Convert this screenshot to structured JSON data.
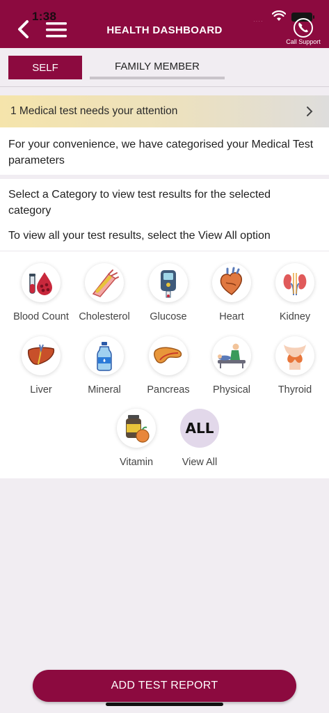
{
  "status_bar": {
    "time": "1:38",
    "signal": "····"
  },
  "header": {
    "title": "HEALTH DASHBOARD",
    "back_icon": "chevron-left-icon",
    "menu_icon": "hamburger-menu-icon",
    "support_icon": "phone-icon",
    "support_label": "Call Support",
    "color": "#8c0a3f"
  },
  "tabs": [
    {
      "label": "SELF",
      "active": true
    },
    {
      "label": "FAMILY MEMBER",
      "active": false
    }
  ],
  "alert": {
    "text": "1 Medical test needs your attention",
    "icon": "chevron-right-icon"
  },
  "info": {
    "text": "For your convenience, we have categorised your Medical Test parameters"
  },
  "categories_panel": {
    "select_text": "Select a Category to view test results for the selected category",
    "view_all_text": "To view all your test results, select the View All option",
    "items": [
      {
        "label": "Blood Count",
        "icon": "blood-count-icon"
      },
      {
        "label": "Cholesterol",
        "icon": "cholesterol-icon"
      },
      {
        "label": "Glucose",
        "icon": "glucose-meter-icon"
      },
      {
        "label": "Heart",
        "icon": "heart-icon"
      },
      {
        "label": "Kidney",
        "icon": "kidney-icon"
      },
      {
        "label": "Liver",
        "icon": "liver-icon"
      },
      {
        "label": "Mineral",
        "icon": "mineral-bottle-icon"
      },
      {
        "label": "Pancreas",
        "icon": "pancreas-icon"
      },
      {
        "label": "Physical",
        "icon": "physical-exam-icon"
      },
      {
        "label": "Thyroid",
        "icon": "thyroid-icon"
      },
      {
        "label": "Vitamin",
        "icon": "vitamin-icon"
      },
      {
        "label": "View All",
        "icon": "all-icon",
        "badge": "ALL"
      }
    ]
  },
  "footer": {
    "add_button": "ADD TEST REPORT"
  }
}
